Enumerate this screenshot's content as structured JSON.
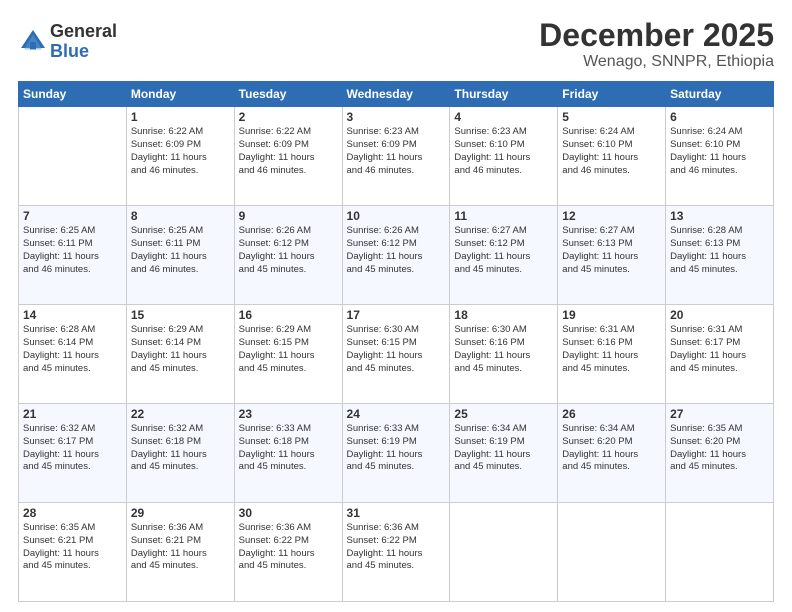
{
  "logo": {
    "general": "General",
    "blue": "Blue"
  },
  "title": "December 2025",
  "subtitle": "Wenago, SNNPR, Ethiopia",
  "days_of_week": [
    "Sunday",
    "Monday",
    "Tuesday",
    "Wednesday",
    "Thursday",
    "Friday",
    "Saturday"
  ],
  "weeks": [
    [
      {
        "day": "",
        "info": ""
      },
      {
        "day": "1",
        "info": "Sunrise: 6:22 AM\nSunset: 6:09 PM\nDaylight: 11 hours\nand 46 minutes."
      },
      {
        "day": "2",
        "info": "Sunrise: 6:22 AM\nSunset: 6:09 PM\nDaylight: 11 hours\nand 46 minutes."
      },
      {
        "day": "3",
        "info": "Sunrise: 6:23 AM\nSunset: 6:09 PM\nDaylight: 11 hours\nand 46 minutes."
      },
      {
        "day": "4",
        "info": "Sunrise: 6:23 AM\nSunset: 6:10 PM\nDaylight: 11 hours\nand 46 minutes."
      },
      {
        "day": "5",
        "info": "Sunrise: 6:24 AM\nSunset: 6:10 PM\nDaylight: 11 hours\nand 46 minutes."
      },
      {
        "day": "6",
        "info": "Sunrise: 6:24 AM\nSunset: 6:10 PM\nDaylight: 11 hours\nand 46 minutes."
      }
    ],
    [
      {
        "day": "7",
        "info": "Sunrise: 6:25 AM\nSunset: 6:11 PM\nDaylight: 11 hours\nand 46 minutes."
      },
      {
        "day": "8",
        "info": "Sunrise: 6:25 AM\nSunset: 6:11 PM\nDaylight: 11 hours\nand 46 minutes."
      },
      {
        "day": "9",
        "info": "Sunrise: 6:26 AM\nSunset: 6:12 PM\nDaylight: 11 hours\nand 45 minutes."
      },
      {
        "day": "10",
        "info": "Sunrise: 6:26 AM\nSunset: 6:12 PM\nDaylight: 11 hours\nand 45 minutes."
      },
      {
        "day": "11",
        "info": "Sunrise: 6:27 AM\nSunset: 6:12 PM\nDaylight: 11 hours\nand 45 minutes."
      },
      {
        "day": "12",
        "info": "Sunrise: 6:27 AM\nSunset: 6:13 PM\nDaylight: 11 hours\nand 45 minutes."
      },
      {
        "day": "13",
        "info": "Sunrise: 6:28 AM\nSunset: 6:13 PM\nDaylight: 11 hours\nand 45 minutes."
      }
    ],
    [
      {
        "day": "14",
        "info": "Sunrise: 6:28 AM\nSunset: 6:14 PM\nDaylight: 11 hours\nand 45 minutes."
      },
      {
        "day": "15",
        "info": "Sunrise: 6:29 AM\nSunset: 6:14 PM\nDaylight: 11 hours\nand 45 minutes."
      },
      {
        "day": "16",
        "info": "Sunrise: 6:29 AM\nSunset: 6:15 PM\nDaylight: 11 hours\nand 45 minutes."
      },
      {
        "day": "17",
        "info": "Sunrise: 6:30 AM\nSunset: 6:15 PM\nDaylight: 11 hours\nand 45 minutes."
      },
      {
        "day": "18",
        "info": "Sunrise: 6:30 AM\nSunset: 6:16 PM\nDaylight: 11 hours\nand 45 minutes."
      },
      {
        "day": "19",
        "info": "Sunrise: 6:31 AM\nSunset: 6:16 PM\nDaylight: 11 hours\nand 45 minutes."
      },
      {
        "day": "20",
        "info": "Sunrise: 6:31 AM\nSunset: 6:17 PM\nDaylight: 11 hours\nand 45 minutes."
      }
    ],
    [
      {
        "day": "21",
        "info": "Sunrise: 6:32 AM\nSunset: 6:17 PM\nDaylight: 11 hours\nand 45 minutes."
      },
      {
        "day": "22",
        "info": "Sunrise: 6:32 AM\nSunset: 6:18 PM\nDaylight: 11 hours\nand 45 minutes."
      },
      {
        "day": "23",
        "info": "Sunrise: 6:33 AM\nSunset: 6:18 PM\nDaylight: 11 hours\nand 45 minutes."
      },
      {
        "day": "24",
        "info": "Sunrise: 6:33 AM\nSunset: 6:19 PM\nDaylight: 11 hours\nand 45 minutes."
      },
      {
        "day": "25",
        "info": "Sunrise: 6:34 AM\nSunset: 6:19 PM\nDaylight: 11 hours\nand 45 minutes."
      },
      {
        "day": "26",
        "info": "Sunrise: 6:34 AM\nSunset: 6:20 PM\nDaylight: 11 hours\nand 45 minutes."
      },
      {
        "day": "27",
        "info": "Sunrise: 6:35 AM\nSunset: 6:20 PM\nDaylight: 11 hours\nand 45 minutes."
      }
    ],
    [
      {
        "day": "28",
        "info": "Sunrise: 6:35 AM\nSunset: 6:21 PM\nDaylight: 11 hours\nand 45 minutes."
      },
      {
        "day": "29",
        "info": "Sunrise: 6:36 AM\nSunset: 6:21 PM\nDaylight: 11 hours\nand 45 minutes."
      },
      {
        "day": "30",
        "info": "Sunrise: 6:36 AM\nSunset: 6:22 PM\nDaylight: 11 hours\nand 45 minutes."
      },
      {
        "day": "31",
        "info": "Sunrise: 6:36 AM\nSunset: 6:22 PM\nDaylight: 11 hours\nand 45 minutes."
      },
      {
        "day": "",
        "info": ""
      },
      {
        "day": "",
        "info": ""
      },
      {
        "day": "",
        "info": ""
      }
    ]
  ]
}
